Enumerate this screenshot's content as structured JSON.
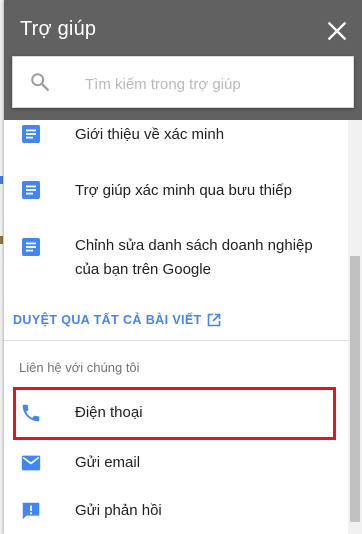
{
  "header": {
    "title": "Trợ giúp"
  },
  "search": {
    "placeholder": "Tìm kiếm trong trợ giúp",
    "value": ""
  },
  "articles": [
    {
      "label": "Giới thiệu về xác minh",
      "icon": "document-icon"
    },
    {
      "label": "Trợ giúp xác minh qua bưu thiếp",
      "icon": "document-icon"
    },
    {
      "label": "Chỉnh sửa danh sách doanh nghiệp của bạn trên Google",
      "icon": "document-icon"
    }
  ],
  "browse_link": {
    "label": "DUYỆT QUA TẤT CẢ BÀI VIẾT",
    "icon": "open-in-new-icon"
  },
  "contact": {
    "title": "Liên hệ với chúng tôi",
    "items": [
      {
        "label": "Điện thoại",
        "icon": "phone-icon",
        "highlighted": true
      },
      {
        "label": "Gửi email",
        "icon": "email-icon"
      },
      {
        "label": "Gửi phản hồi",
        "icon": "feedback-icon"
      }
    ]
  },
  "colors": {
    "header_bg": "#616161",
    "accent_blue": "#4285f4",
    "highlight_red": "#e0151f",
    "text_primary": "#212121",
    "text_secondary": "#757575"
  }
}
